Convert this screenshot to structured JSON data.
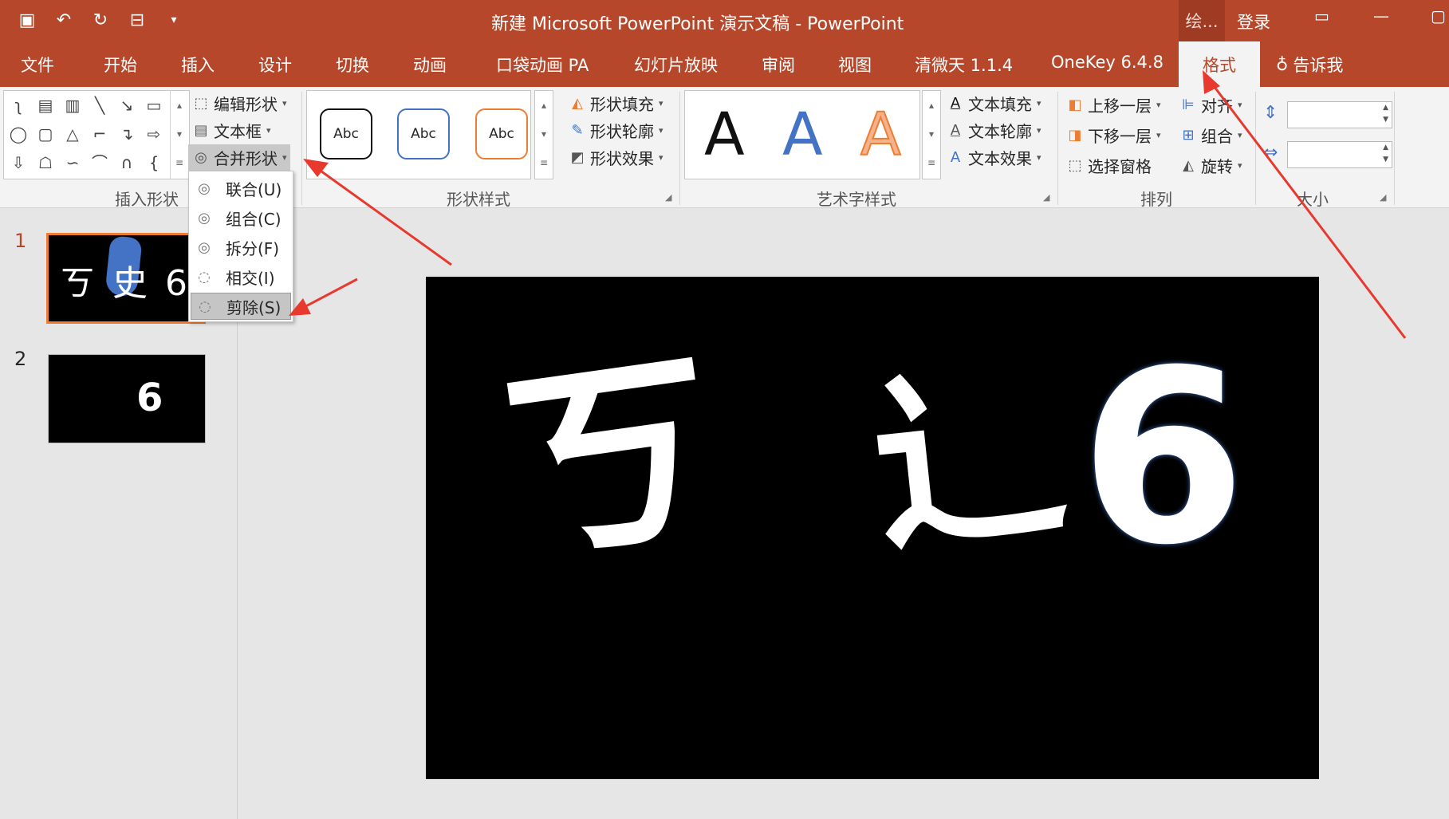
{
  "titlebar": {
    "title": "新建 Microsoft PowerPoint 演示文稿  -  PowerPoint",
    "context_tab": "绘...",
    "login": "登录",
    "restore_glyph": "▭",
    "minimize_glyph": "—",
    "maximize_glyph": "▢"
  },
  "tabs": [
    "文件",
    "开始",
    "插入",
    "设计",
    "切换",
    "动画",
    "口袋动画 PA",
    "幻灯片放映",
    "审阅",
    "视图",
    "清微天 1.1.4",
    "OneKey 6.4.8",
    "格式",
    "告诉我"
  ],
  "ribbon": {
    "insert_shapes": {
      "label": "插入形状",
      "edit_shape": "编辑形状",
      "textbox": "文本框",
      "merge_shapes": "合并形状"
    },
    "shape_styles": {
      "label": "形状样式",
      "sample": "Abc",
      "fill": "形状填充",
      "outline": "形状轮廓",
      "effects": "形状效果"
    },
    "wordart_styles": {
      "label": "艺术字样式",
      "sample": "A",
      "text_fill": "文本填充",
      "text_outline": "文本轮廓",
      "text_effects": "文本效果"
    },
    "arrange": {
      "label": "排列",
      "bring_forward": "上移一层",
      "send_backward": "下移一层",
      "selection_pane": "选择窗格",
      "align": "对齐",
      "group": "组合",
      "rotate": "旋转"
    },
    "size": {
      "label": "大小"
    }
  },
  "merge_menu": {
    "items": [
      "联合(U)",
      "组合(C)",
      "拆分(F)",
      "相交(I)",
      "剪除(S)"
    ],
    "selected": "剪除(S)"
  },
  "slides": [
    {
      "number": "1",
      "thumb_text": "ㄎ 史 6"
    },
    {
      "number": "2",
      "thumb_text": "6"
    }
  ],
  "slide_content": {
    "glyph_left": "ㄎ",
    "glyph_mid": "辶",
    "glyph_right": "6"
  },
  "colors": {
    "accent": "#b7472a",
    "thumb_highlight": "#4472c4",
    "menu_selected": "#c5c5c5",
    "arrow": "#e8392f"
  }
}
